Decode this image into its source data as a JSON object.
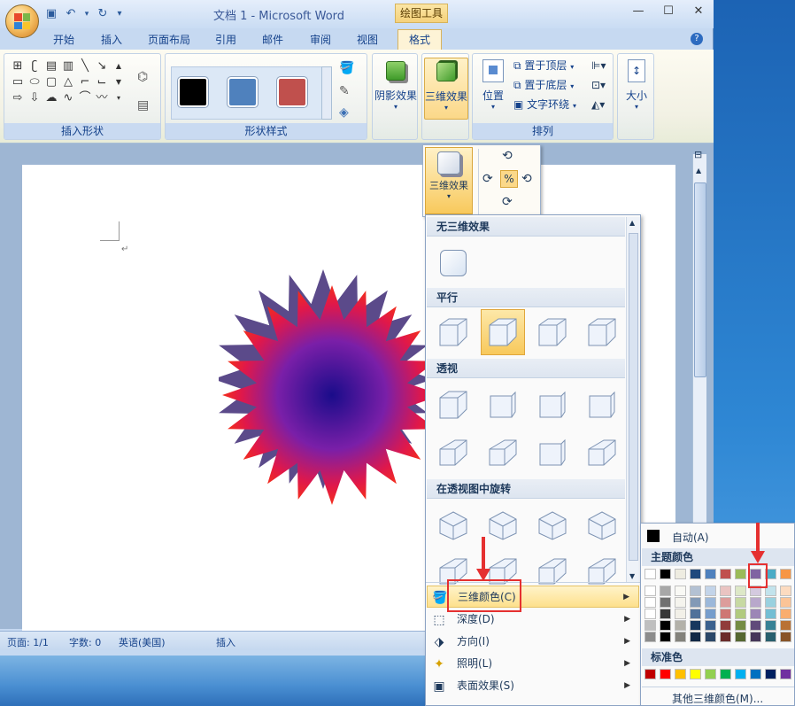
{
  "window": {
    "title": "文档 1 - Microsoft Word",
    "context_tab_group": "绘图工具"
  },
  "qat": {
    "save": "save-icon",
    "undo": "undo-icon",
    "redo": "redo-icon",
    "more": "▾"
  },
  "tabs": [
    "开始",
    "插入",
    "页面布局",
    "引用",
    "邮件",
    "审阅",
    "视图",
    "格式"
  ],
  "active_tab": "格式",
  "ribbon": {
    "groups": {
      "insert_shapes": "插入形状",
      "shape_styles": "形状样式",
      "arrange": "排列"
    },
    "buttons": {
      "shadow": "阴影效果",
      "effect3d": "三维效果",
      "position": "位置",
      "bring_front": "置于顶层",
      "send_back": "置于底层",
      "text_wrap": "文字环绕",
      "size": "大小"
    },
    "style_colors": [
      "#000000",
      "#4f81bd",
      "#c0504d"
    ]
  },
  "popup_3d": {
    "label": "三维效果"
  },
  "dropdown": {
    "sections": {
      "none": "无三维效果",
      "parallel": "平行",
      "perspective": "透视",
      "rotate_persp": "在透视图中旋转"
    },
    "menu": [
      {
        "label": "三维颜色(C)",
        "icon": "paint-bucket-icon"
      },
      {
        "label": "深度(D)",
        "icon": "depth-icon"
      },
      {
        "label": "方向(I)",
        "icon": "direction-icon"
      },
      {
        "label": "照明(L)",
        "icon": "lighting-icon"
      },
      {
        "label": "表面效果(S)",
        "icon": "surface-icon"
      }
    ]
  },
  "color_panel": {
    "auto": "自动(A)",
    "theme_colors": "主题颜色",
    "standard_colors": "标准色",
    "more_colors": "其他三维颜色(M)...",
    "theme_row": [
      "#ffffff",
      "#000000",
      "#eeece1",
      "#1f497d",
      "#4f81bd",
      "#c0504d",
      "#9bbb59",
      "#8064a2",
      "#4bacc6",
      "#f79646"
    ],
    "standard_row": [
      "#c00000",
      "#ff0000",
      "#ffc000",
      "#ffff00",
      "#92d050",
      "#00b050",
      "#00b0f0",
      "#0070c0",
      "#002060",
      "#7030a0"
    ]
  },
  "status": {
    "page": "页面: 1/1",
    "words": "字数: 0",
    "lang": "英语(美国)",
    "mode": "插入"
  }
}
